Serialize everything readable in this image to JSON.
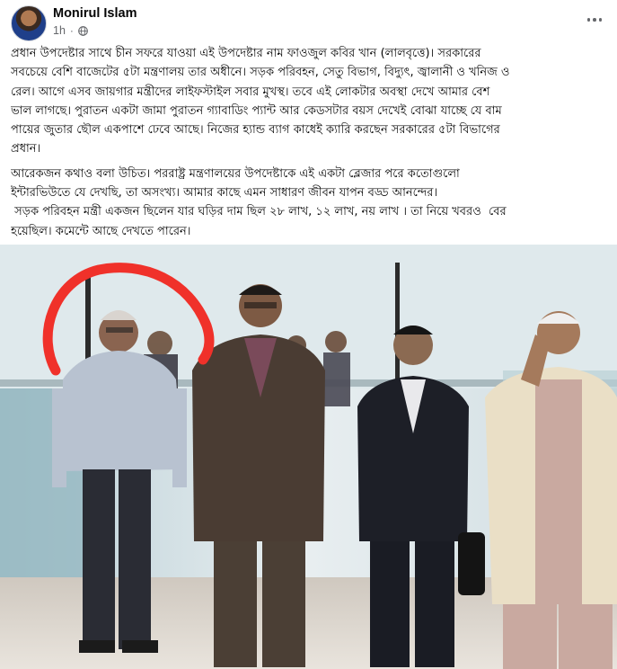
{
  "post": {
    "author": "Monirul Islam",
    "time": "1h",
    "privacy_icon": "globe-icon",
    "more_icon": "more-horizontal-icon",
    "paragraphs": [
      [
        "প্রধান উপদেষ্টার সাথে চীন সফরে যাওয়া এই উপদেষ্টার নাম ফাওজুল কবির খান (লালবৃত্তে)। সরকারের",
        "সবচেয়ে বেশি বাজেটের ৫টা মন্ত্রণালয় তার অধীনে। সড়ক পরিবহন, সেতু বিভাগ, বিদ্যুৎ, জ্বালানী ও খনিজ ও",
        "রেল। আগে এসব জায়গার মন্ত্রীদের লাইফস্টাইল সবার মুখস্থ। তবে এই লোকটার অবস্থা দেখে আমার বেশ",
        "ভাল লাগছে। পুরাতন একটা জামা পুরাতন গ্যাবাডিং প্যান্ট আর কেডসটার বয়স দেখেই বোঝা যাচ্ছে যে বাম",
        "পায়ের জুতার ছৌল একপাশে ঢেবে আছে। নিজের হ্যান্ড ব্যাগ কাধেই ক্যারি করছেন সরকারের ৫টা বিভাগের",
        "প্রধান।"
      ],
      [
        "আরেকজন কথাও বলা উচিত। পররাষ্ট্র মন্ত্রণালয়ের উপদেষ্টাকে এই একটা ব্লেজার পরে কতোগুলো",
        "ইন্টারভিউতে যে দেখছি, তা অসংখ্য। আমার কাছে এমন সাধারণ জীবন যাপন বড্ড আনন্দের।",
        " সড়ক পরিবহন মন্ত্রী একজন ছিলেন যার ঘড়ির দাম ছিল ২৮ লাখ, ১২ লাখ, নয় লাখ । তা নিয়ে খবরও  বের",
        "হয়েছিল। কমেন্টে আছে দেখতে পারেন।"
      ]
    ]
  },
  "photo": {
    "annotation_color": "#f0312a"
  }
}
